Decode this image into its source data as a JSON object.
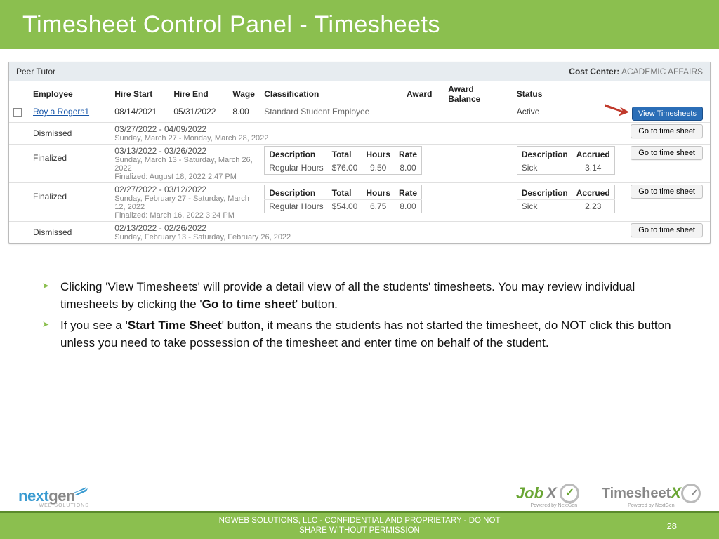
{
  "title": "Timesheet Control Panel - Timesheets",
  "panel": {
    "role": "Peer Tutor",
    "cost_center_label": "Cost Center:",
    "cost_center_value": "ACADEMIC AFFAIRS",
    "columns": {
      "employee": "Employee",
      "hire_start": "Hire Start",
      "hire_end": "Hire End",
      "wage": "Wage",
      "classification": "Classification",
      "award": "Award",
      "award_balance": "Award Balance",
      "status": "Status"
    },
    "employee": {
      "name": "Roy a Rogers1",
      "hire_start": "08/14/2021",
      "hire_end": "05/31/2022",
      "wage": "8.00",
      "classification": "Standard Student Employee",
      "award": "",
      "award_balance": "",
      "status": "Active",
      "view_btn": "View Timesheets"
    },
    "mini_headers": {
      "description": "Description",
      "total": "Total",
      "hours": "Hours",
      "rate": "Rate",
      "accrued_desc": "Description",
      "accrued": "Accrued"
    },
    "go_btn": "Go to time sheet",
    "periods": [
      {
        "status": "Dismissed",
        "range": "03/27/2022 - 04/09/2022",
        "detail": "Sunday, March 27 - Monday, March 28, 2022",
        "has_hours": false
      },
      {
        "status": "Finalized",
        "range": "03/13/2022 - 03/26/2022",
        "detail": "Sunday, March 13 - Saturday, March 26, 2022",
        "finalized": "Finalized: August 18, 2022 2:47 PM",
        "has_hours": true,
        "hours": {
          "desc": "Regular Hours",
          "total": "$76.00",
          "hours": "9.50",
          "rate": "8.00"
        },
        "accrued": {
          "desc": "Sick",
          "val": "3.14"
        }
      },
      {
        "status": "Finalized",
        "range": "02/27/2022 - 03/12/2022",
        "detail": "Sunday, February 27 - Saturday, March 12, 2022",
        "finalized": "Finalized: March 16, 2022 3:24 PM",
        "has_hours": true,
        "hours": {
          "desc": "Regular Hours",
          "total": "$54.00",
          "hours": "6.75",
          "rate": "8.00"
        },
        "accrued": {
          "desc": "Sick",
          "val": "2.23"
        }
      },
      {
        "status": "Dismissed",
        "range": "02/13/2022 - 02/26/2022",
        "detail": "Sunday, February 13 - Saturday, February 26, 2022",
        "has_hours": false
      }
    ]
  },
  "bullets": {
    "b1_a": "Clicking 'View Timesheets' will provide a detail view of all the students' timesheets. You may review individual timesheets by clicking the '",
    "b1_bold": "Go to time sheet",
    "b1_b": "' button.",
    "b2_a": "If you see a '",
    "b2_bold": "Start Time Sheet",
    "b2_b": "' button, it means the students has not started the timesheet, do NOT click this button unless you need to take possession of the timesheet and enter time on behalf of the student."
  },
  "footer": {
    "confidential_l1": "NGWEB SOLUTIONS, LLC - CONFIDENTIAL AND  PROPRIETARY - DO NOT",
    "confidential_l2": "SHARE WITHOUT PERMISSION",
    "page": "28",
    "powered": "Powered by NextGen"
  },
  "logos": {
    "ng_next": "next",
    "ng_gen": "gen",
    "ng_sub": "WEB SOLUTIONS",
    "jx_job": "Job",
    "jx_x": "X",
    "tx_ts": "Timesheet",
    "tx_x": "X"
  }
}
